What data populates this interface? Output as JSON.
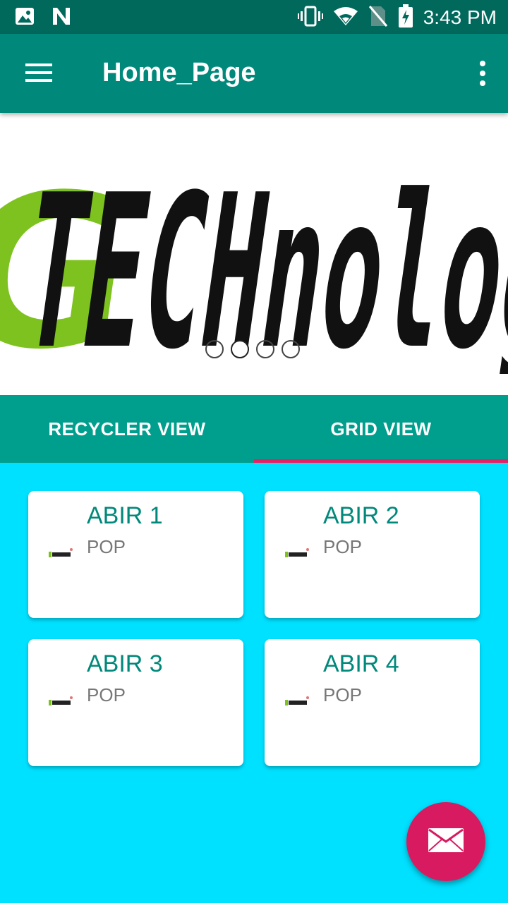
{
  "status_bar": {
    "time": "3:43 PM",
    "left_icons": [
      "image-icon",
      "n-notification-icon"
    ],
    "right_icons": [
      "vibrate-icon",
      "wifi-icon",
      "no-sim-icon",
      "battery-charging-icon"
    ]
  },
  "app_bar": {
    "title": "Home_Page",
    "menu_icon": "hamburger-menu-icon",
    "overflow_icon": "overflow-menu-icon",
    "color": "#00897B"
  },
  "banner": {
    "logo_text_accent": "G",
    "logo_text": "TECHnolog",
    "page_count": 4,
    "active_page": 2
  },
  "tabs": [
    {
      "label": "RECYCLER VIEW",
      "selected": false
    },
    {
      "label": "GRID VIEW",
      "selected": true
    }
  ],
  "grid_items": [
    {
      "title": "ABIR 1",
      "subtitle": "POP"
    },
    {
      "title": "ABIR 2",
      "subtitle": "POP"
    },
    {
      "title": "ABIR 3",
      "subtitle": "POP"
    },
    {
      "title": "ABIR 4",
      "subtitle": "POP"
    }
  ],
  "fab": {
    "icon": "email-icon",
    "color": "#D81B60"
  },
  "colors": {
    "status_bar": "#00695C",
    "tab_bar": "#009E8C",
    "tab_indicator": "#E91E63",
    "background": "#00E0FF"
  }
}
